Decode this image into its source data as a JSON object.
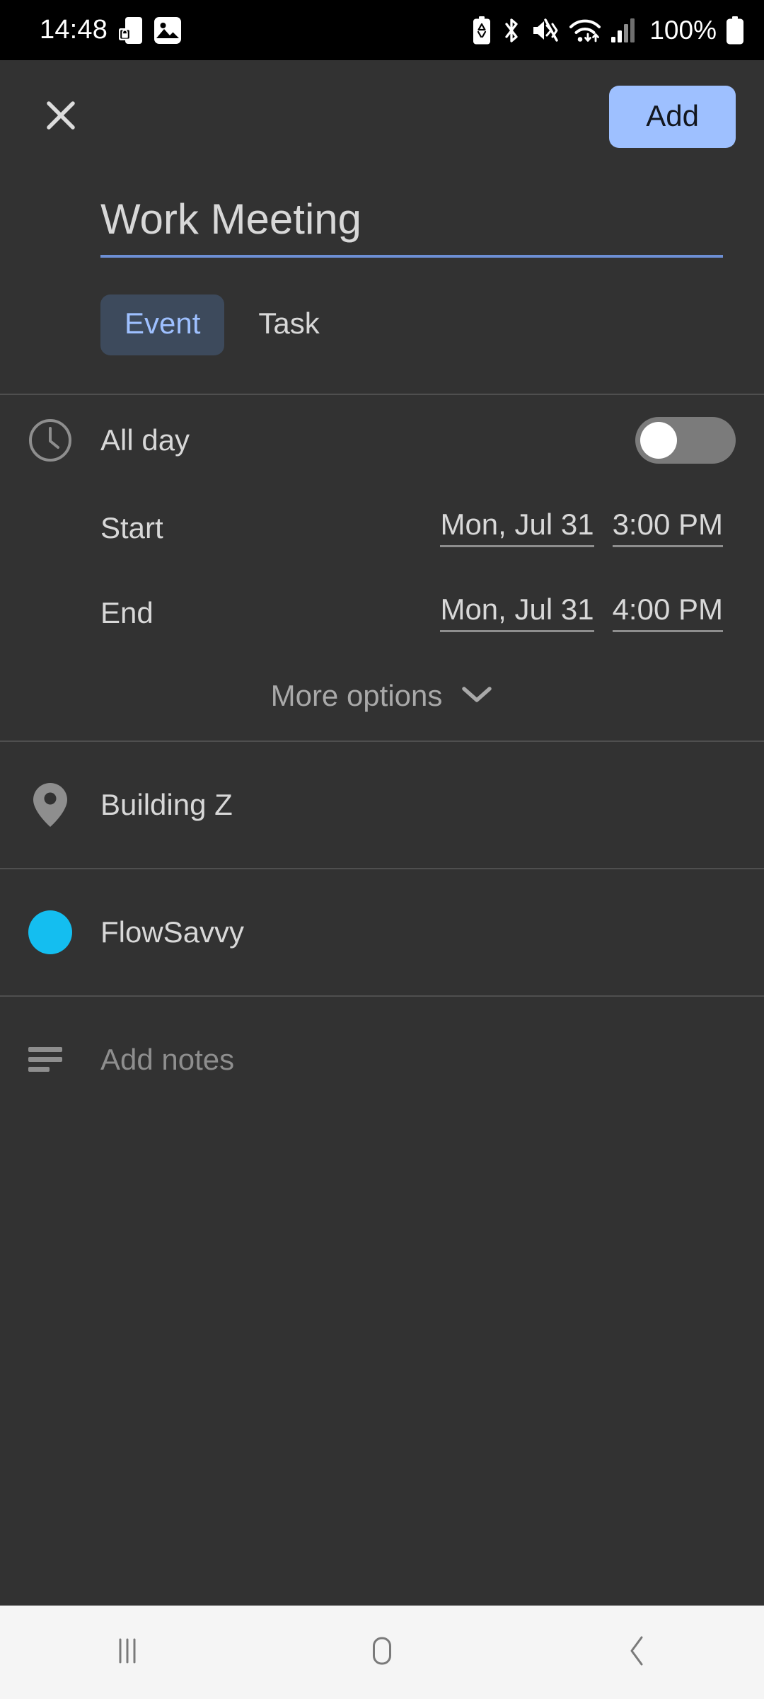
{
  "status_bar": {
    "time": "14:48",
    "battery_percent": "100%",
    "left_icons": [
      "phone-lock-icon",
      "image-icon"
    ],
    "right_icons": [
      "battery-saver-icon",
      "bluetooth-icon",
      "mute-vibrate-icon",
      "wifi-icon",
      "cellular-signal-icon"
    ],
    "background_color": "#000000"
  },
  "action_bar": {
    "close_icon": "close-icon",
    "add_label": "Add",
    "add_button_color": "#9ec0ff"
  },
  "event_form": {
    "title_value": "Work Meeting",
    "title_placeholder": "Add title",
    "title_underline_color": "#6d8fd4",
    "tabs": [
      {
        "label": "Event",
        "active": true
      },
      {
        "label": "Task",
        "active": false
      }
    ],
    "all_day": {
      "icon": "clock-icon",
      "label": "All day",
      "enabled": false
    },
    "start": {
      "label": "Start",
      "date": "Mon, Jul 31",
      "time": "3:00 PM"
    },
    "end": {
      "label": "End",
      "date": "Mon, Jul 31",
      "time": "4:00 PM"
    },
    "more_options": {
      "label": "More options",
      "icon": "chevron-down-icon"
    },
    "location": {
      "icon": "location-pin-icon",
      "value": "Building Z"
    },
    "calendar": {
      "icon": "calendar-color-dot",
      "color": "#14bef0",
      "name": "FlowSavvy"
    },
    "notes": {
      "icon": "notes-lines-icon",
      "placeholder": "Add notes",
      "value": ""
    }
  },
  "nav_bar": {
    "background_color": "#f5f5f5",
    "buttons": [
      {
        "name": "recents",
        "icon": "recents-icon"
      },
      {
        "name": "home",
        "icon": "home-icon"
      },
      {
        "name": "back",
        "icon": "back-icon"
      }
    ]
  }
}
